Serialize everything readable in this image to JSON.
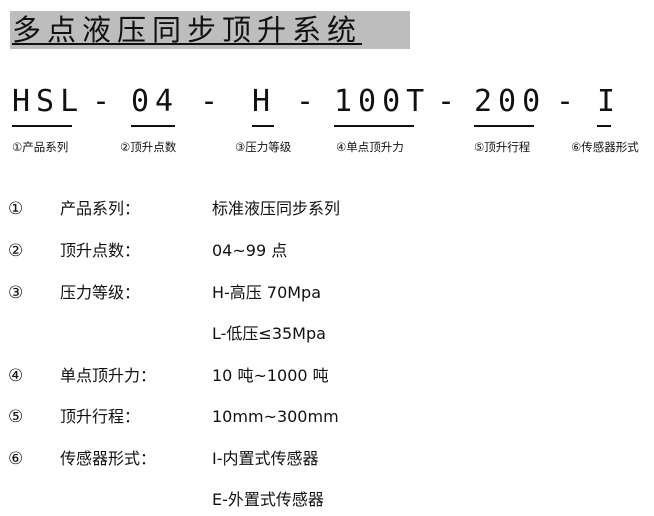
{
  "title": "多点液压同步顶升系统",
  "model": {
    "parts": [
      "HSL",
      "04",
      "H",
      "100T",
      "200",
      "I"
    ],
    "separators": [
      "-",
      "-",
      "-",
      "-",
      "-"
    ]
  },
  "captions": [
    "①产品系列",
    "②顶升点数",
    "③压力等级",
    "④单点顶升力",
    "⑤顶升行程",
    "⑥传感器形式"
  ],
  "specs": [
    {
      "num": "①",
      "label": "产品系列：",
      "value": "标准液压同步系列"
    },
    {
      "num": "②",
      "label": "顶升点数：",
      "value": "04~99 点"
    },
    {
      "num": "③",
      "label": "压力等级：",
      "value": "H-高压 70Mpa"
    },
    {
      "num": "",
      "label": "",
      "value": "L-低压≤35Mpa"
    },
    {
      "num": "④",
      "label": "单点顶升力：",
      "value": "10 吨~1000 吨"
    },
    {
      "num": "⑤",
      "label": "顶升行程：",
      "value": "10mm~300mm"
    },
    {
      "num": "⑥",
      "label": "传感器形式：",
      "value": "I-内置式传感器"
    },
    {
      "num": "",
      "label": "",
      "value": "E-外置式传感器"
    }
  ]
}
